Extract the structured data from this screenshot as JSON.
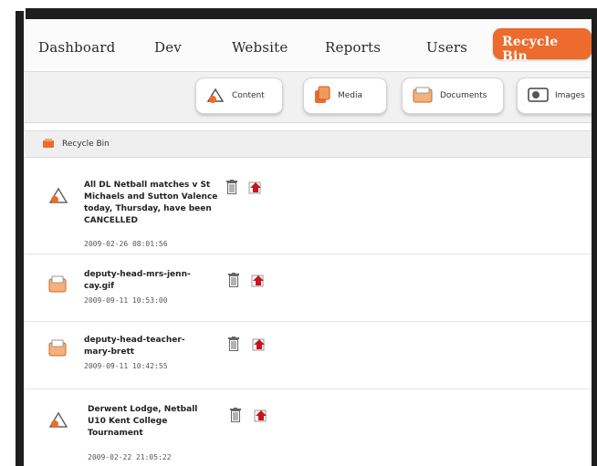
{
  "nav": {
    "items": [
      "Dashboard",
      "Dev",
      "Website",
      "Reports",
      "Users"
    ],
    "active": "Recycle Bin"
  },
  "sections": [
    "Content",
    "Media",
    "Documents",
    "Images"
  ],
  "panel": {
    "title": "Recycle Bin"
  },
  "items": [
    {
      "type": "content",
      "title": "All DL Netball matches v St Michaels and Sutton Valence today, Thursday, have been CANCELLED",
      "date": "2009-02-26 08:01:56"
    },
    {
      "type": "document",
      "title": "deputy-head-mrs-jenn-cay.gif",
      "date": "2009-09-11 10:53:00"
    },
    {
      "type": "document",
      "title": "deputy-head-teacher-mary-brett",
      "date": "2009-09-11 10:42:55"
    },
    {
      "type": "content",
      "title": "Derwent Lodge, Netball U10 Kent College Tournament",
      "date": "2009-02-22 21:05:22"
    }
  ],
  "colors": {
    "accent": "#ec6b2d",
    "restore": "#c4161c"
  },
  "icons": {
    "delete": "trash-icon",
    "restore": "restore-icon"
  }
}
